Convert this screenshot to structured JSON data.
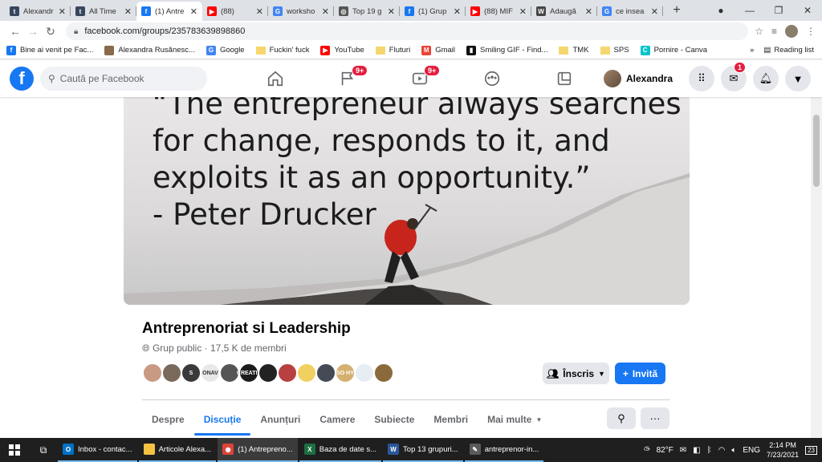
{
  "browser": {
    "tabs": [
      {
        "title": "Alexandr",
        "icon": "tumblr-icon",
        "color": "#36465d",
        "letter": "t"
      },
      {
        "title": "All Time",
        "icon": "tumblr-icon",
        "color": "#36465d",
        "letter": "t"
      },
      {
        "title": "(1) Antre",
        "icon": "facebook-icon",
        "color": "#1877f2",
        "letter": "f",
        "active": true
      },
      {
        "title": "(88)",
        "icon": "youtube-icon",
        "color": "#ff0000",
        "letter": "▶"
      },
      {
        "title": "worksho",
        "icon": "google-icon",
        "color": "#4285f4",
        "letter": "G"
      },
      {
        "title": "Top 19 g",
        "icon": "generic-icon",
        "color": "#555555",
        "letter": "◎"
      },
      {
        "title": "(1) Grup",
        "icon": "facebook-icon",
        "color": "#1877f2",
        "letter": "f"
      },
      {
        "title": "(88) MIF",
        "icon": "youtube-icon",
        "color": "#ff0000",
        "letter": "▶"
      },
      {
        "title": "Adaugă",
        "icon": "wordpress-icon",
        "color": "#464646",
        "letter": "W"
      },
      {
        "title": "ce insea",
        "icon": "google-icon",
        "color": "#4285f4",
        "letter": "G"
      }
    ],
    "url": "facebook.com/groups/235783639898860",
    "bookmarks": [
      {
        "label": "Bine ai venit pe Fac...",
        "type": "fb"
      },
      {
        "label": "Alexandra Rusănesc...",
        "type": "img"
      },
      {
        "label": "Google",
        "type": "google"
      },
      {
        "label": "Fuckin' fuck",
        "type": "folder"
      },
      {
        "label": "YouTube",
        "type": "yt"
      },
      {
        "label": "Fluturi",
        "type": "folder"
      },
      {
        "label": "Gmail",
        "type": "gmail"
      },
      {
        "label": "Smiling GIF - Find...",
        "type": "giphy"
      },
      {
        "label": "TMK",
        "type": "folder"
      },
      {
        "label": "SPS",
        "type": "folder"
      },
      {
        "label": "Pornire - Canva",
        "type": "canva"
      }
    ],
    "reading_list": "Reading list",
    "more": "»"
  },
  "facebook": {
    "search_placeholder": "Caută pe Facebook",
    "badges": {
      "pages": "9+",
      "watch": "9+",
      "messenger": "1"
    },
    "user_name": "Alexandra"
  },
  "cover": {
    "quote_lines": [
      "“The entrepreneur always searches",
      "for change, responds to it, and",
      "exploits it as an opportunity.”",
      "- Peter Drucker"
    ]
  },
  "group": {
    "name": "Antreprenoriat si Leadership",
    "meta": "Grup public · 17,5 K de membri",
    "join_label": "Înscris",
    "invite_label": "Invită",
    "member_avatars": [
      "#c89a84",
      "#7a6a5c",
      "#3a3a3a",
      "#e8e8e8",
      "#555555",
      "#1b1b1b",
      "#222222",
      "#b84040",
      "#f0d060",
      "#444b55",
      "#d4b070",
      "#e6eef4",
      "#8a6a3a"
    ],
    "member_labels": [
      "",
      "",
      "S",
      "ONAV",
      "",
      "CREATIV",
      "",
      "",
      "",
      "",
      "SO HY",
      "",
      ""
    ],
    "tabs": [
      "Despre",
      "Discuție",
      "Anunțuri",
      "Camere",
      "Subiecte",
      "Membri",
      "Mai multe"
    ],
    "active_tab": 1
  },
  "taskbar": {
    "items": [
      {
        "label": "Inbox - contac...",
        "color": "#0072c6",
        "letter": "O"
      },
      {
        "label": "Articole Alexa...",
        "color": "#f5c242",
        "letter": ""
      },
      {
        "label": "(1) Antrepreno...",
        "color": "#db4437",
        "letter": "◉",
        "active": true
      },
      {
        "label": "Baza de date s...",
        "color": "#1d6f42",
        "letter": "X"
      },
      {
        "label": "Top 13 grupuri...",
        "color": "#2b579a",
        "letter": "W"
      },
      {
        "label": "antreprenor-in...",
        "color": "#5a5a5a",
        "letter": "✎"
      }
    ],
    "weather": "82°F",
    "lang": "ENG",
    "time": "2:14 PM",
    "date": "7/23/2021",
    "notif_count": "23"
  }
}
